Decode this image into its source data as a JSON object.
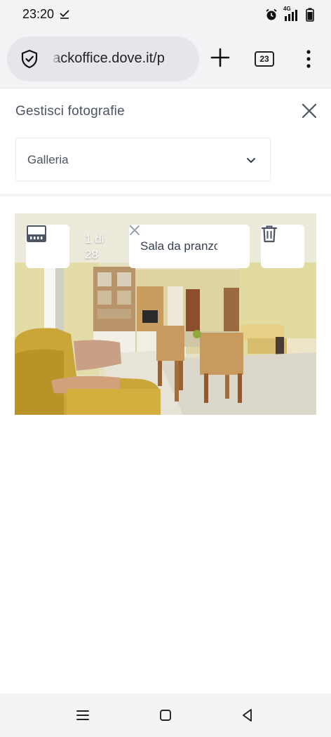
{
  "status_bar": {
    "time": "23:20",
    "network": "4G",
    "icons": [
      "download-done-icon",
      "alarm-icon",
      "signal-icon",
      "battery-icon"
    ]
  },
  "browser": {
    "url": "backoffice.dove.it/p",
    "tab_count": "23",
    "icons": [
      "shield-icon",
      "plus-icon",
      "tabs-icon",
      "more-vert-icon"
    ]
  },
  "panel": {
    "title": "Gestisci fotografie",
    "select": {
      "value": "Galleria"
    }
  },
  "photo": {
    "index_line1": "1 di",
    "index_line2": "28",
    "caption": "Sala da pranzo",
    "icons": [
      "set-cover-icon",
      "clear-caption-icon",
      "delete-icon"
    ]
  },
  "nav_bar": {
    "icons": [
      "menu-icon",
      "home-icon",
      "back-icon"
    ]
  },
  "colors": {
    "chrome_bg": "#f3f3f6",
    "url_pill": "#e5e5ea",
    "panel_text": "#4b5563"
  }
}
